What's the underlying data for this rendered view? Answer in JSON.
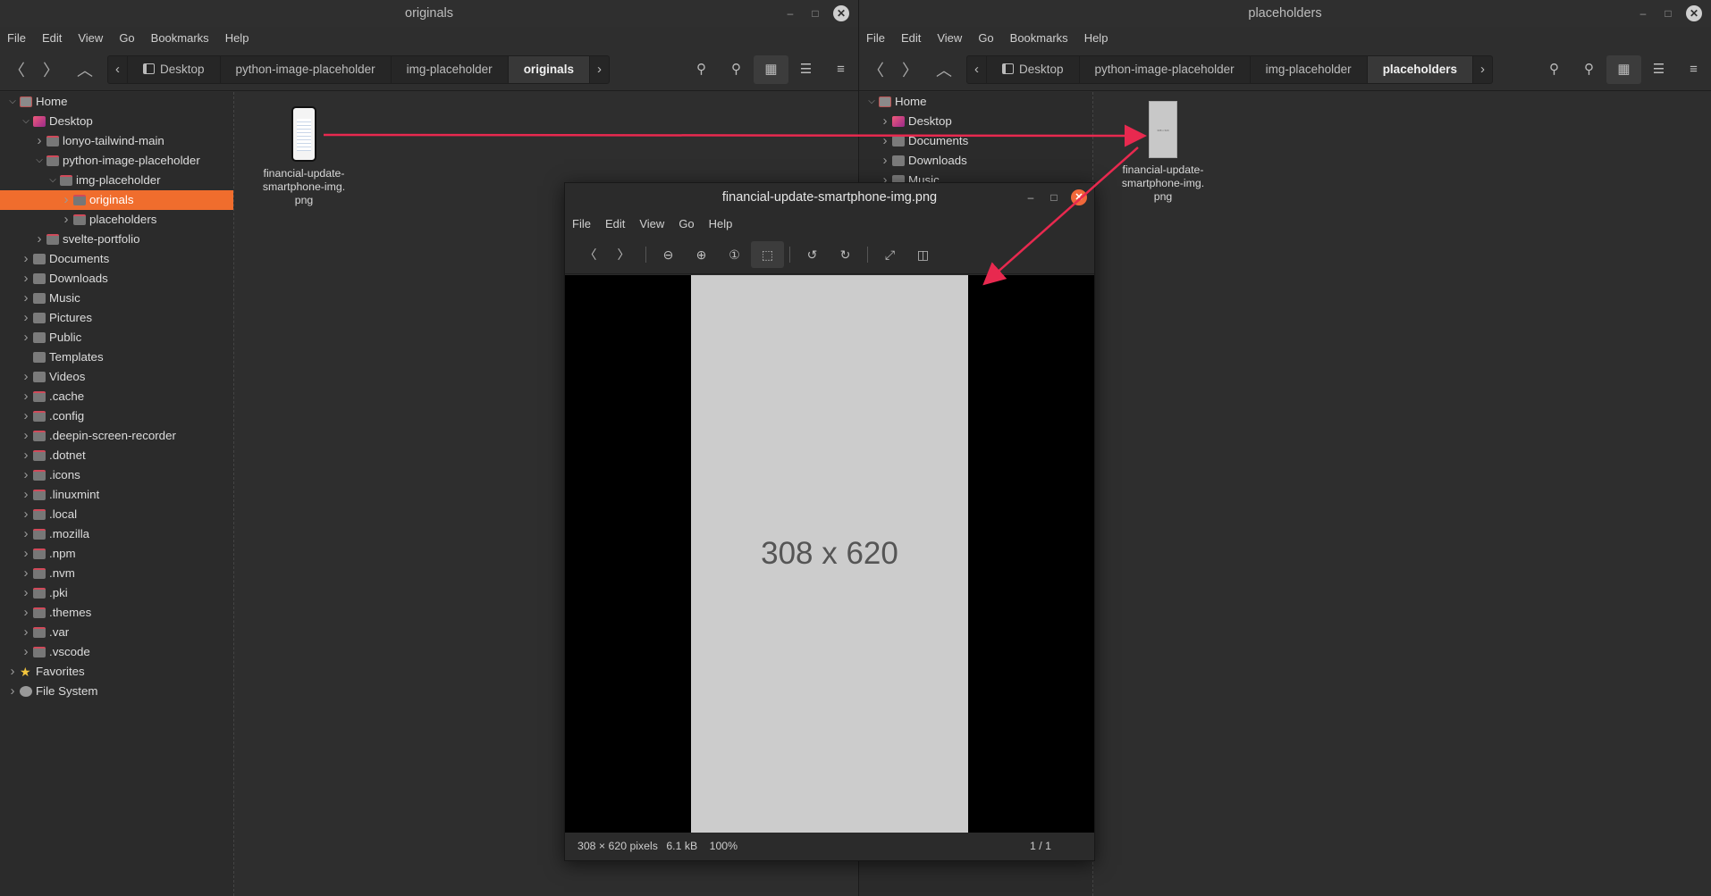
{
  "left_window": {
    "title": "originals",
    "menu": [
      "File",
      "Edit",
      "View",
      "Go",
      "Bookmarks",
      "Help"
    ],
    "breadcrumbs": [
      "Desktop",
      "python-image-placeholder",
      "img-placeholder",
      "originals"
    ],
    "sidebar": [
      {
        "label": "Home",
        "depth": 0,
        "expanded": true,
        "icon": "home-folder-icon"
      },
      {
        "label": "Desktop",
        "depth": 1,
        "expanded": true,
        "icon": "desktop-folder-icon"
      },
      {
        "label": "lonyo-tailwind-main",
        "depth": 2,
        "expanded": false,
        "icon": "folder-icon"
      },
      {
        "label": "python-image-placeholder",
        "depth": 2,
        "expanded": true,
        "icon": "folder-icon"
      },
      {
        "label": "img-placeholder",
        "depth": 3,
        "expanded": true,
        "icon": "folder-icon"
      },
      {
        "label": "originals",
        "depth": 4,
        "expanded": false,
        "icon": "folder-icon",
        "selected": true
      },
      {
        "label": "placeholders",
        "depth": 4,
        "expanded": false,
        "icon": "folder-icon"
      },
      {
        "label": "svelte-portfolio",
        "depth": 2,
        "expanded": false,
        "icon": "folder-icon"
      },
      {
        "label": "Documents",
        "depth": 1,
        "expanded": false,
        "icon": "documents-folder-icon"
      },
      {
        "label": "Downloads",
        "depth": 1,
        "expanded": false,
        "icon": "downloads-folder-icon"
      },
      {
        "label": "Music",
        "depth": 1,
        "expanded": false,
        "icon": "music-folder-icon"
      },
      {
        "label": "Pictures",
        "depth": 1,
        "expanded": false,
        "icon": "pictures-folder-icon"
      },
      {
        "label": "Public",
        "depth": 1,
        "expanded": false,
        "icon": "public-folder-icon"
      },
      {
        "label": "Templates",
        "depth": 1,
        "expanded": null,
        "icon": "templates-folder-icon"
      },
      {
        "label": "Videos",
        "depth": 1,
        "expanded": false,
        "icon": "videos-folder-icon"
      },
      {
        "label": ".cache",
        "depth": 1,
        "expanded": false,
        "icon": "folder-icon"
      },
      {
        "label": ".config",
        "depth": 1,
        "expanded": false,
        "icon": "folder-icon"
      },
      {
        "label": ".deepin-screen-recorder",
        "depth": 1,
        "expanded": false,
        "icon": "folder-icon"
      },
      {
        "label": ".dotnet",
        "depth": 1,
        "expanded": false,
        "icon": "folder-icon"
      },
      {
        "label": ".icons",
        "depth": 1,
        "expanded": false,
        "icon": "folder-icon"
      },
      {
        "label": ".linuxmint",
        "depth": 1,
        "expanded": false,
        "icon": "folder-icon"
      },
      {
        "label": ".local",
        "depth": 1,
        "expanded": false,
        "icon": "folder-icon"
      },
      {
        "label": ".mozilla",
        "depth": 1,
        "expanded": false,
        "icon": "folder-icon"
      },
      {
        "label": ".npm",
        "depth": 1,
        "expanded": false,
        "icon": "folder-icon"
      },
      {
        "label": ".nvm",
        "depth": 1,
        "expanded": false,
        "icon": "folder-icon"
      },
      {
        "label": ".pki",
        "depth": 1,
        "expanded": false,
        "icon": "folder-icon"
      },
      {
        "label": ".themes",
        "depth": 1,
        "expanded": false,
        "icon": "folder-icon"
      },
      {
        "label": ".var",
        "depth": 1,
        "expanded": false,
        "icon": "folder-icon"
      },
      {
        "label": ".vscode",
        "depth": 1,
        "expanded": false,
        "icon": "folder-icon"
      },
      {
        "label": "Favorites",
        "depth": 0,
        "expanded": false,
        "icon": "star-icon"
      },
      {
        "label": "File System",
        "depth": 0,
        "expanded": false,
        "icon": "drive-icon"
      }
    ],
    "file": {
      "name_lines": [
        "financial-update-",
        "smartphone-img.",
        "png"
      ]
    }
  },
  "right_window": {
    "title": "placeholders",
    "menu": [
      "File",
      "Edit",
      "View",
      "Go",
      "Bookmarks",
      "Help"
    ],
    "breadcrumbs": [
      "Desktop",
      "python-image-placeholder",
      "img-placeholder",
      "placeholders"
    ],
    "sidebar": [
      {
        "label": "Home",
        "depth": 0,
        "expanded": true,
        "icon": "home-folder-icon"
      },
      {
        "label": "Desktop",
        "depth": 1,
        "expanded": false,
        "icon": "desktop-folder-icon"
      },
      {
        "label": "Documents",
        "depth": 1,
        "expanded": false,
        "icon": "documents-folder-icon"
      },
      {
        "label": "Downloads",
        "depth": 1,
        "expanded": false,
        "icon": "downloads-folder-icon"
      },
      {
        "label": "Music",
        "depth": 1,
        "expanded": false,
        "icon": "music-folder-icon"
      }
    ],
    "file": {
      "name_lines": [
        "financial-update-",
        "smartphone-img.",
        "png"
      ],
      "thumb_text": "308 x 620"
    }
  },
  "viewer": {
    "title": "financial-update-smartphone-img.png",
    "menu": [
      "File",
      "Edit",
      "View",
      "Go",
      "Help"
    ],
    "image_text": "308 x 620",
    "status": {
      "dims": "308 × 620 pixels",
      "size": "6.1 kB",
      "zoom": "100%",
      "page": "1 / 1"
    }
  },
  "colors": {
    "selection": "#f06d2d",
    "arrow": "#e8294f",
    "placeholder_gray": "#cccccc",
    "close_orange": "#f0683a"
  }
}
